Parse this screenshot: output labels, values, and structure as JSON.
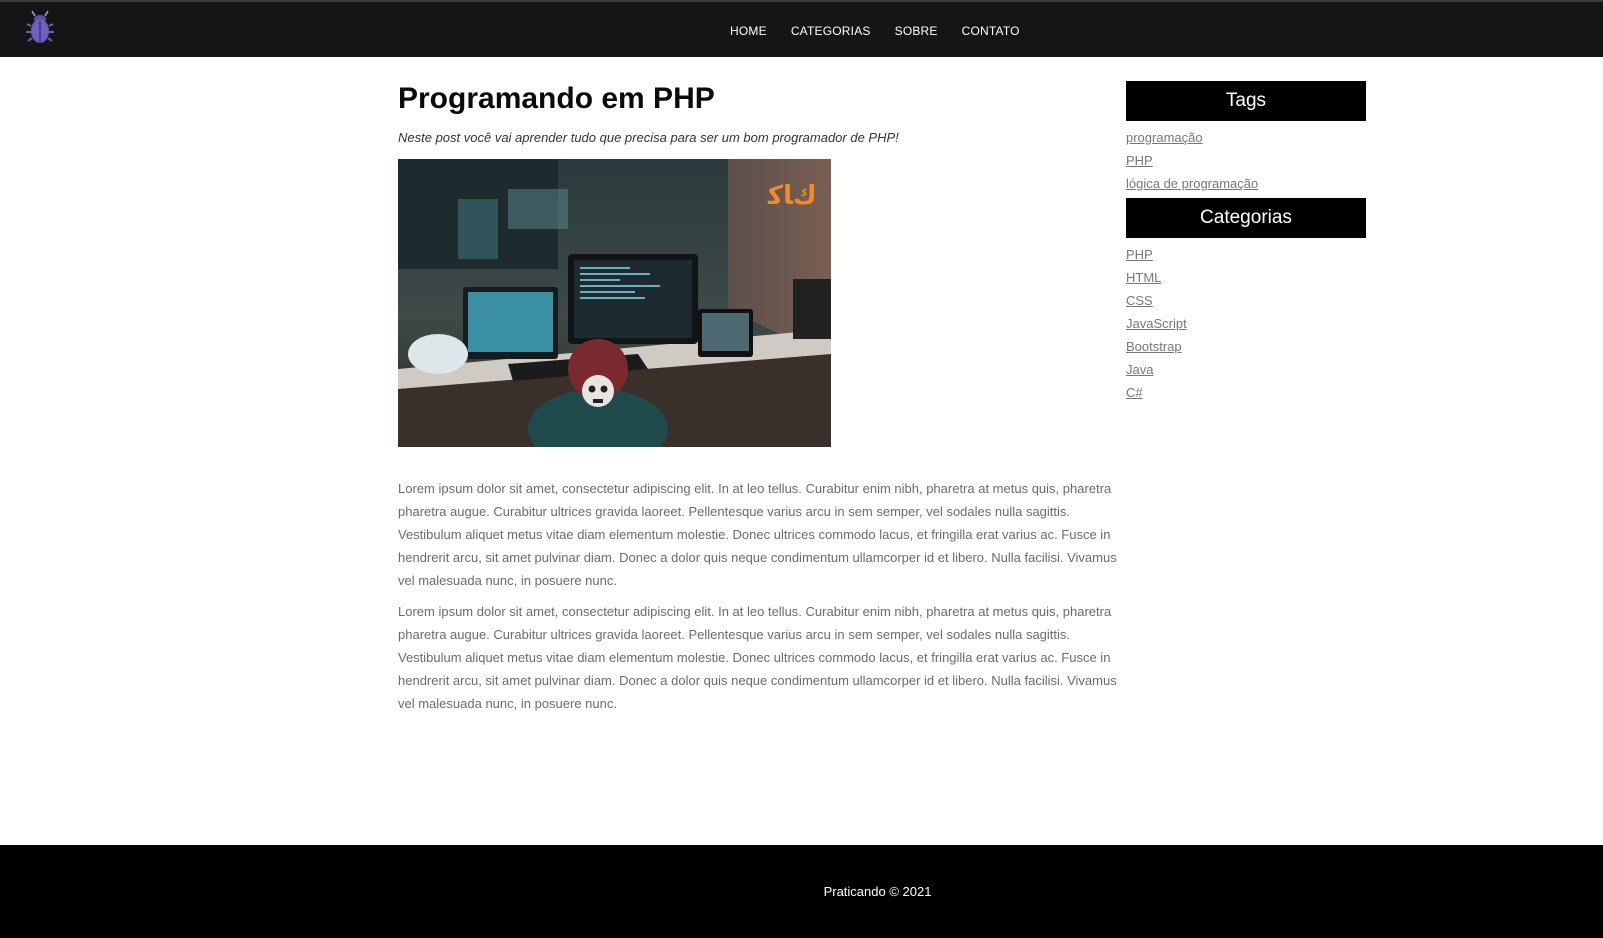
{
  "header": {
    "logo_icon": "bug-icon",
    "nav": [
      {
        "label": "HOME"
      },
      {
        "label": "CATEGORIAS"
      },
      {
        "label": "SOBRE"
      },
      {
        "label": "CONTATO"
      }
    ]
  },
  "post": {
    "title": "Programando em PHP",
    "subtitle": "Neste post você vai aprender tudo que precisa para ser um bom programador de PHP!",
    "paragraphs": [
      "Lorem ipsum dolor sit amet, consectetur adipiscing elit. In at leo tellus. Curabitur enim nibh, pharetra at metus quis, pharetra pharetra augue. Curabitur ultrices gravida laoreet. Pellentesque varius arcu in sem semper, vel sodales nulla sagittis. Vestibulum aliquet metus vitae diam elementum molestie. Donec ultrices commodo lacus, et fringilla erat varius ac. Fusce in hendrerit arcu, sit amet pulvinar diam. Donec a dolor quis neque condimentum ullamcorper id et libero. Nulla facilisi. Vivamus vel malesuada nunc, in posuere nunc.",
      "Lorem ipsum dolor sit amet, consectetur adipiscing elit. In at leo tellus. Curabitur enim nibh, pharetra at metus quis, pharetra pharetra augue. Curabitur ultrices gravida laoreet. Pellentesque varius arcu in sem semper, vel sodales nulla sagittis. Vestibulum aliquet metus vitae diam elementum molestie. Donec ultrices commodo lacus, et fringilla erat varius ac. Fusce in hendrerit arcu, sit amet pulvinar diam. Donec a dolor quis neque condimentum ullamcorper id et libero. Nulla facilisi. Vivamus vel malesuada nunc, in posuere nunc."
    ]
  },
  "sidebar": {
    "tags_title": "Tags",
    "tags": [
      "programação",
      "PHP",
      "lógica de programação"
    ],
    "categories_title": "Categorias",
    "categories": [
      "PHP",
      "HTML",
      "CSS",
      "JavaScript",
      "Bootstrap",
      "Java",
      "C#"
    ]
  },
  "footer": {
    "text": "Praticando © 2021"
  },
  "colors": {
    "header_bg": "#151515",
    "footer_bg": "#000000",
    "sidebar_head_bg": "#000000",
    "link": "#777777"
  }
}
